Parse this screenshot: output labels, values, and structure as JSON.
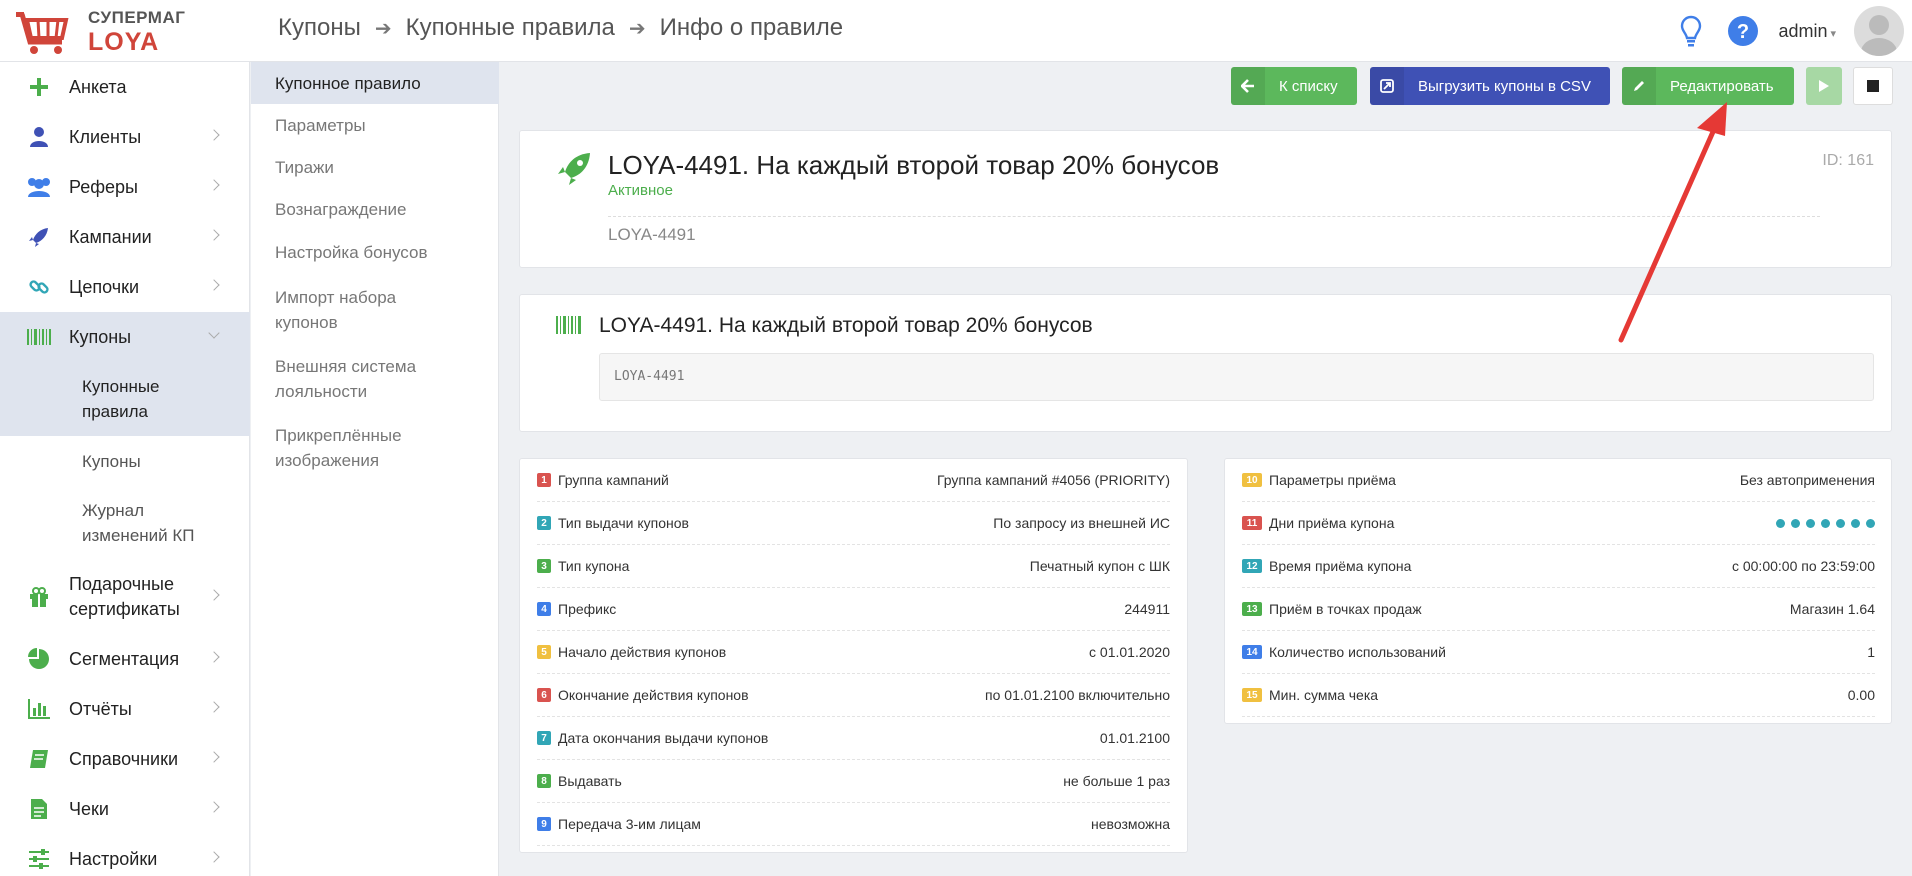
{
  "brand": {
    "line1": "СУПЕРМАГ",
    "line2": "LOYA"
  },
  "breadcrumb": [
    "Купоны",
    "Купонные правила",
    "Инфо о правиле"
  ],
  "header": {
    "user": "admin"
  },
  "sidebar": {
    "items": [
      {
        "label": "Анкета",
        "icon": "plus-icon"
      },
      {
        "label": "Клиенты",
        "icon": "user-icon"
      },
      {
        "label": "Реферы",
        "icon": "users-icon"
      },
      {
        "label": "Кампании",
        "icon": "rocket-icon"
      },
      {
        "label": "Цепочки",
        "icon": "link-icon"
      },
      {
        "label": "Купоны",
        "icon": "barcode-icon"
      },
      {
        "label": "Подарочные сертификаты",
        "icon": "gift-icon"
      },
      {
        "label": "Сегментация",
        "icon": "pie-icon"
      },
      {
        "label": "Отчёты",
        "icon": "chart-icon"
      },
      {
        "label": "Справочники",
        "icon": "book-icon"
      },
      {
        "label": "Чеки",
        "icon": "receipt-icon"
      },
      {
        "label": "Настройки",
        "icon": "sliders-icon"
      }
    ],
    "sub": [
      "Купонные правила",
      "Купоны",
      "Журнал изменений КП"
    ]
  },
  "sidebar2": [
    "Купонное правило",
    "Параметры",
    "Тиражи",
    "Вознаграждение",
    "Настройка бонусов",
    "Импорт набора купонов",
    "Внешняя система лояльности",
    "Прикреплённые изображения"
  ],
  "toolbar": {
    "back": "К списку",
    "export": "Выгрузить купоны в CSV",
    "edit": "Редактировать"
  },
  "rule": {
    "title": "LOYA-4491. На каждый второй товар 20% бонусов",
    "status": "Активное",
    "id": "ID: 161",
    "code": "LOYA-4491"
  },
  "coupon": {
    "title": "LOYA-4491. На каждый второй товар 20% бонусов",
    "code": "LOYA-4491"
  },
  "params_left": [
    {
      "n": "1",
      "k": "Группа кампаний",
      "v": "Группа кампаний #4056 (PRIORITY)",
      "c": "#d9534f"
    },
    {
      "n": "2",
      "k": "Тип выдачи купонов",
      "v": "По запросу из внешней ИС",
      "c": "#31a6b6"
    },
    {
      "n": "3",
      "k": "Тип купона",
      "v": "Печатный купон с ШК",
      "c": "#4cae4c"
    },
    {
      "n": "4",
      "k": "Префикс",
      "v": "244911",
      "c": "#3f7ee8"
    },
    {
      "n": "5",
      "k": "Начало действия купонов",
      "v": "с 01.01.2020",
      "c": "#f0c040"
    },
    {
      "n": "6",
      "k": "Окончание действия купонов",
      "v": "по 01.01.2100 включительно",
      "c": "#d9534f"
    },
    {
      "n": "7",
      "k": "Дата окончания выдачи купонов",
      "v": "01.01.2100",
      "c": "#31a6b6"
    },
    {
      "n": "8",
      "k": "Выдавать",
      "v": "не больше 1 раз",
      "c": "#4cae4c"
    },
    {
      "n": "9",
      "k": "Передача 3-им лицам",
      "v": "невозможна",
      "c": "#3f7ee8"
    }
  ],
  "params_right": [
    {
      "n": "10",
      "k": "Параметры приёма",
      "v": "Без автоприменения",
      "c": "#f0c040"
    },
    {
      "n": "11",
      "k": "Дни приёма купона",
      "v": "",
      "c": "#d9534f"
    },
    {
      "n": "12",
      "k": "Время приёма купона",
      "v": "с 00:00:00 по 23:59:00",
      "c": "#31a6b6"
    },
    {
      "n": "13",
      "k": "Приём в точках продаж",
      "v": "Магазин 1.64",
      "c": "#4cae4c"
    },
    {
      "n": "14",
      "k": "Количество использований",
      "v": "1",
      "c": "#3f7ee8"
    },
    {
      "n": "15",
      "k": "Мин. сумма чека",
      "v": "0.00",
      "c": "#f0c040"
    }
  ],
  "colors": {
    "accent_green": "#5cb85c",
    "accent_blue": "#3f51b5",
    "brand_red": "#d0453a"
  }
}
